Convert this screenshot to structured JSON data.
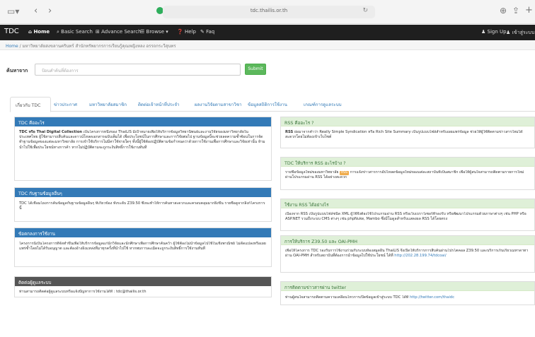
{
  "browser": {
    "url": "tdc.thailis.or.th",
    "icons": [
      "sidebar-icon",
      "back-icon",
      "forward-icon",
      "shield-icon",
      "reload-icon",
      "download-icon",
      "share-icon",
      "new-tab-icon"
    ]
  },
  "nav": {
    "brand": "TDC",
    "items": [
      "Home",
      "Basic Search",
      "Advance Search",
      "Browse",
      "Help",
      "Faq"
    ],
    "signup": "Sign Up",
    "login": "เข้าสู่ระบบ"
  },
  "breadcrumb": {
    "home": "Home",
    "text": "/ มหาวิทยาลัยสงขลานครินทร์ สำนักทรัพยากรการเรียนรู้คุณหญิงหลง อรรถกระวีสุนทร"
  },
  "search": {
    "label": "ค้นหาจาก",
    "placeholder": "ป้อนคำค้นที่ต้องการ",
    "button": "Submit"
  },
  "tabs": [
    "เกี่ยวกับ TDC",
    "ข่าวประกาศ",
    "มหาวิทยาลัยสมาชิก",
    "ติดต่อเจ้าหน้าที่ประจำ",
    "ผลงานวิจัยตามสาขาวิชา",
    "ข้อมูลสถิติการใช้งาน",
    "เกณฑ์การดูแลระบบ"
  ],
  "left_panels": [
    {
      "title": "TDC คืออะไร",
      "lead": "TDC หรือ Thai Digital Collection",
      "body": " เป็นโครงการหนึ่งของ ThaiLIS มีเป้าหมายเพื่อให้บริการข้อมูลวิทยานิพนธ์และงานวิจัยของมหาวิทยาลัยในประเทศไทย ผู้ใช้สามารถสืบค้นและดาวน์โหลดเอกสารฉบับเต็มได้ เพื่อประโยชน์ในการศึกษาและการวิจัยต่อไป ฐานข้อมูลนี้จะช่วยลดความซ้ำซ้อนในการจัดทำฐานข้อมูลของแต่ละมหาวิทยาลัย การเข้าใช้บริการไม่มีค่าใช้จ่ายใดๆ ทั้งนี้ผู้ใช้ต้องปฏิบัติตามข้อกำหนดว่าด้วยการใช้งานเพื่อการศึกษาและวิจัยเท่านั้น ห้ามนำไปใช้เพื่อประโยชน์ทางการค้า หากไม่ปฏิบัติตามจะถูกระงับสิทธิ์การใช้งานทันที"
    },
    {
      "title": "TDC กับฐานข้อมูลอื่นๆ",
      "body": "TDC ได้เชื่อมโยงการค้นข้อมูลกับฐานข้อมูลอื่นๆ ที่เกี่ยวข้อง ทั้งระดับ Z39.50 ซึ่งจะทำให้การค้นหาสะดวกและครอบคลุมมากยิ่งขึ้น รายชื่อดูจากลิงก์โครงการนี้"
    },
    {
      "title": "ข้อตกลงการใช้งาน",
      "body": "โครงการนี้เป็นโครงการที่จัดทำขึ้นเพื่อให้บริการข้อมูลแก่นักวิจัยและนักศึกษาเพื่อการศึกษาค้นคว้า ผู้ใช้ต้องไม่นำข้อมูลไปใช้ในเชิงพาณิชย์ ไม่ดัดแปลงหรือเผยแพร่ซ้ำโดยไม่ได้รับอนุญาต และต้องอ้างอิงแหล่งที่มาทุกครั้งที่นำไปใช้ หากพบการละเมิดจะถูกระงับสิทธิ์การใช้งานทันที"
    },
    {
      "title": "ติดต่อผู้ดูแลระบบ",
      "body": "ท่านสามารถติดต่อผู้ดูแลระบบหรือแจ้งปัญหาการใช้งานได้ที่ : tdc@thailis.or.th"
    }
  ],
  "right_panels": [
    {
      "title": "RSS คืออะไร ?",
      "lead": "RSS",
      "body": " ย่อมาจากคำว่า Really Simple Syndication หรือ Rich Site Summary เป็นรูปแบบไฟล์สำหรับเผยแพร่ข้อมูล ช่วยให้ผู้ใช้ติดตามข่าวสารใหม่ได้สะดวกโดยไม่ต้องเข้าเว็บไซต์"
    },
    {
      "title": "TDC ให้บริการ RSS อะไรบ้าง ?",
      "lead": "รายชื่อข้อมูลใหม่ของมหาวิทยาลัย",
      "badge": "RSS",
      "body": " การแจ้งข่าวสารการอัปโหลดข้อมูลใหม่ของแต่ละสถาบันที่เป็นสมาชิก เพื่อให้ผู้สนใจสามารถติดตามรายการใหม่ผ่านโปรแกรมอ่าน RSS ได้อย่างสะดวก"
    },
    {
      "title": "ใช้งาน RSS ได้อย่างไร",
      "body": "เนื่องจาก RSS เป็นรูปแบบไฟล์ชนิด XML ผู้ใช้จึงต้องใช้โปรแกรมอ่าน RSS หรือเว็บเบราว์เซอร์ที่รองรับ หรือพัฒนาโปรแกรมด้วยภาษาต่างๆ เช่น PHP หรือ ASP.NET รวมถึงระบบ CMS ต่างๆ เช่น phpNuke, Mambo ซึ่งมีโมดูลสำหรับแสดงผล RSS ได้โดยตรง"
    },
    {
      "title": "การให้บริการ Z39.50 และ OAI-PMH",
      "body": "เพื่อให้โครงการ TDC รองรับการใช้งานร่วมกับระบบห้องสมุดอื่น ThaiLIS จึงเปิดให้บริการการสืบค้นผ่านโปรโตคอล Z39.50 และบริการเก็บเกี่ยวเมทาดาทาผ่าน OAI-PMH สำหรับสถาบันที่ต้องการนำข้อมูลไปใช้ประโยชน์ ได้ที่",
      "link": "http://202.28.199.74/tdcoai/"
    },
    {
      "title": "การติดตามข่าวสารผ่าน twitter",
      "body": "ท่านผู้สนใจสามารถติดตามความเคลื่อนไหวการเปิดข้อมูลเข้าสู่ระบบ TDC ได้ที่ ",
      "link": "http://twitter.com/thaidc"
    }
  ]
}
